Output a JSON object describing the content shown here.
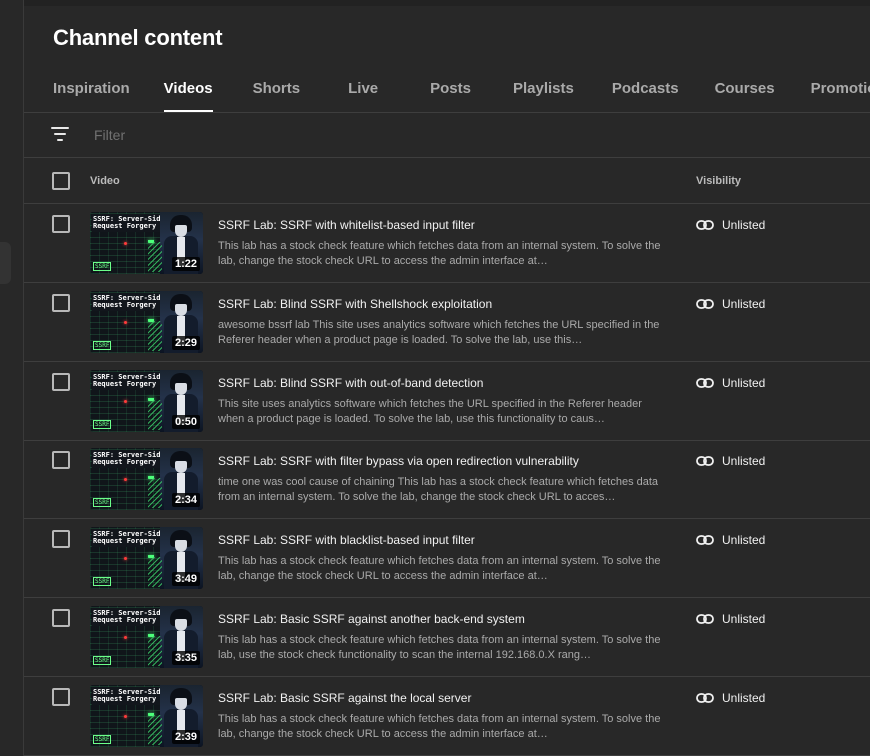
{
  "page": {
    "title": "Channel content"
  },
  "tabs": [
    {
      "label": "Inspiration",
      "active": false
    },
    {
      "label": "Videos",
      "active": true
    },
    {
      "label": "Shorts",
      "active": false
    },
    {
      "label": "Live",
      "active": false
    },
    {
      "label": "Posts",
      "active": false
    },
    {
      "label": "Playlists",
      "active": false
    },
    {
      "label": "Podcasts",
      "active": false
    },
    {
      "label": "Courses",
      "active": false
    },
    {
      "label": "Promotions",
      "active": false
    }
  ],
  "filter": {
    "placeholder": "Filter",
    "icon": "filter-icon"
  },
  "table": {
    "columns": {
      "video": "Video",
      "visibility": "Visibility"
    },
    "rows": [
      {
        "title": "SSRF Lab: SSRF with whitelist-based input filter",
        "description": "This lab has a stock check feature which fetches data from an internal system. To solve the lab, change the stock check URL to access the admin interface at…",
        "duration": "1:22",
        "visibility": "Unlisted"
      },
      {
        "title": "SSRF Lab: Blind SSRF with Shellshock exploitation",
        "description": "awesome bssrf lab This site uses analytics software which fetches the URL specified in the Referer header when a product page is loaded. To solve the lab, use this…",
        "duration": "2:29",
        "visibility": "Unlisted"
      },
      {
        "title": "SSRF Lab: Blind SSRF with out-of-band detection",
        "description": "This site uses analytics software which fetches the URL specified in the Referer header when a product page is loaded. To solve the lab, use this functionality to caus…",
        "duration": "0:50",
        "visibility": "Unlisted"
      },
      {
        "title": "SSRF Lab: SSRF with filter bypass via open redirection vulnerability",
        "description": "time one was cool cause of chaining This lab has a stock check feature which fetches data from an internal system. To solve the lab, change the stock check URL to acces…",
        "duration": "2:34",
        "visibility": "Unlisted"
      },
      {
        "title": "SSRF Lab: SSRF with blacklist-based input filter",
        "description": "This lab has a stock check feature which fetches data from an internal system. To solve the lab, change the stock check URL to access the admin interface at…",
        "duration": "3:49",
        "visibility": "Unlisted"
      },
      {
        "title": "SSRF Lab: Basic SSRF against another back-end system",
        "description": "This lab has a stock check feature which fetches data from an internal system. To solve the lab, use the stock check functionality to scan the internal 192.168.0.X rang…",
        "duration": "3:35",
        "visibility": "Unlisted"
      },
      {
        "title": "SSRF Lab: Basic SSRF against the local server",
        "description": "This lab has a stock check feature which fetches data from an internal system. To solve the lab, change the stock check URL to access the admin interface at…",
        "duration": "2:39",
        "visibility": "Unlisted"
      }
    ]
  },
  "thumbnail": {
    "line1": "SSRF: Server-Side",
    "line2": "Request Forgery",
    "tag": "SSRF"
  },
  "colors": {
    "background": "#282828",
    "text": "#f1f1f1",
    "muted": "#aaaaaa",
    "divider": "#3e3e3e"
  }
}
